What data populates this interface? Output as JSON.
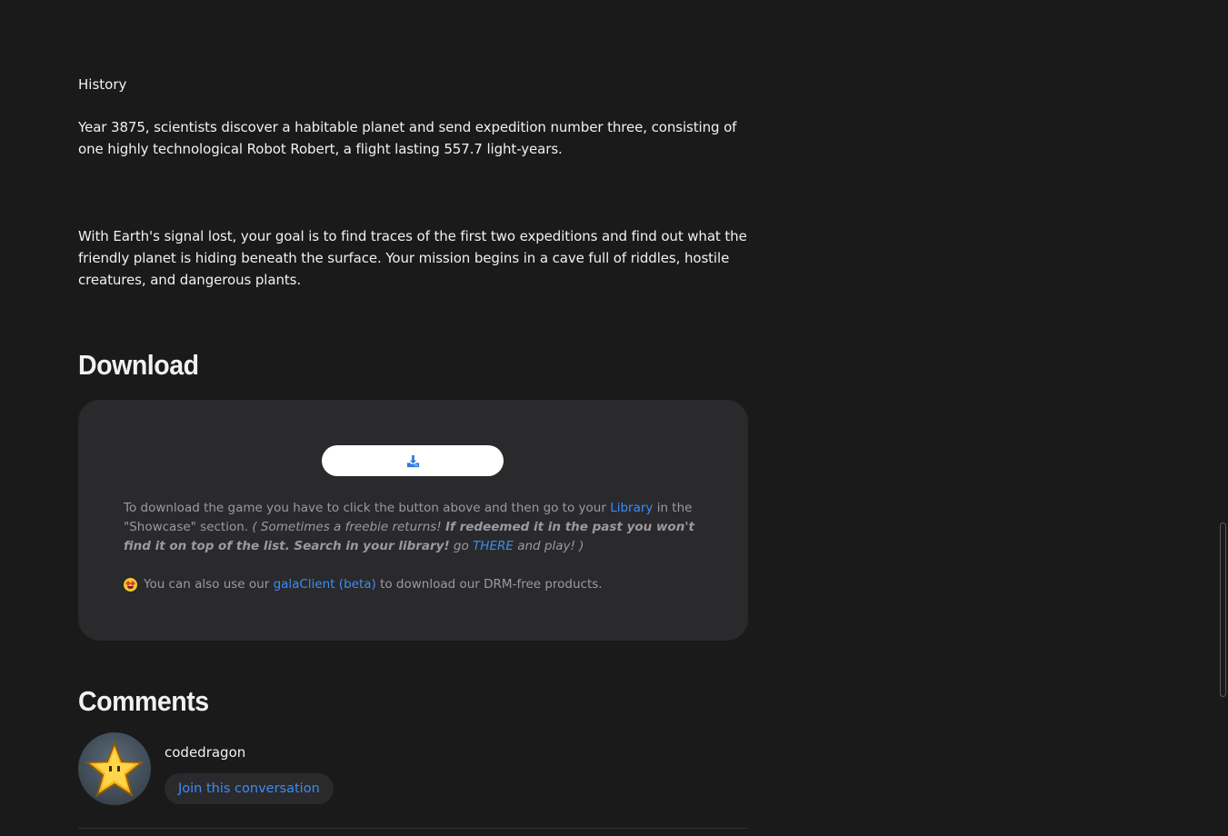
{
  "about": {
    "history_heading": "History",
    "paragraph_1": "Year 3875, scientists discover a habitable planet and send expedition number three, consisting of one highly technological Robot Robert, a flight lasting 557.7 light-years.",
    "paragraph_2": "With Earth's signal lost, your goal is to find traces of the first two expeditions and find out what the friendly planet is hiding beneath the surface. Your mission begins in a cave full of riddles, hostile creatures, and dangerous plants."
  },
  "download": {
    "title": "Download",
    "button_icon": "download-icon",
    "text_1": "To download the game you have to click the button above and then go to your ",
    "library_link": "Library",
    "text_2": " in the \"Showcase\" section. ",
    "italic_1": "( Sometimes a freebie returns! ",
    "bold_italic": "If redeemed it in the past you won't find it on top of the list. Search in your library!",
    "italic_2": " go ",
    "there_link": "THERE",
    "italic_3": " and play! )",
    "client_emoji": "star-struck-emoji",
    "client_text_1": "You can also use our ",
    "client_link": "galaClient (beta)",
    "client_text_2": " to download our DRM-free products."
  },
  "comments": {
    "title": "Comments",
    "username": "codedragon",
    "join_label": "Join this conversation",
    "avatar_icon": "star-avatar"
  },
  "colors": {
    "background": "#1a1a1b",
    "card": "#2a2a2c",
    "link": "#3a8df5",
    "muted_text": "#9a9aa0"
  }
}
